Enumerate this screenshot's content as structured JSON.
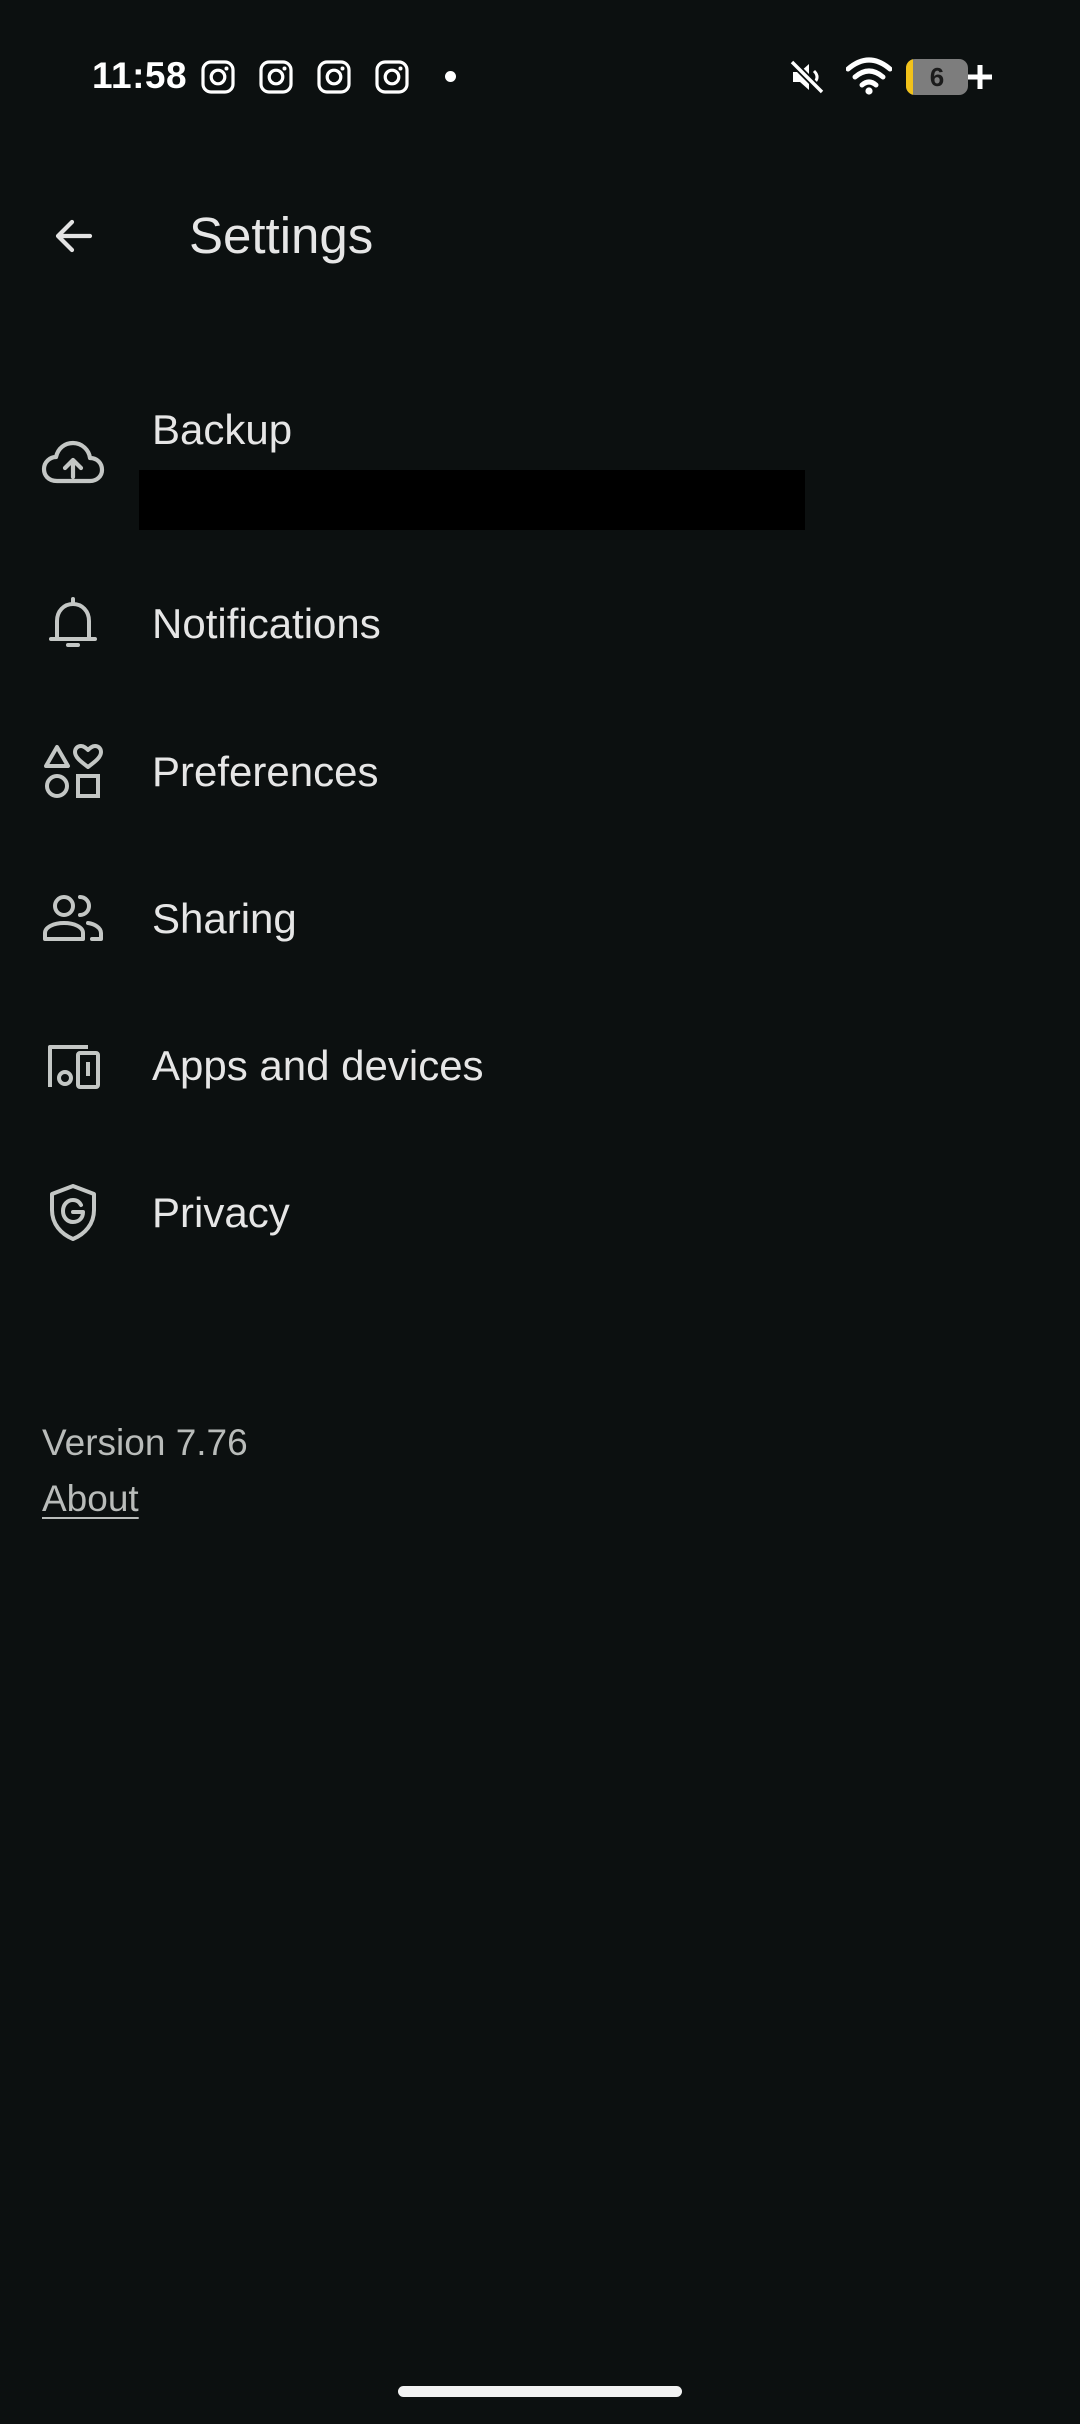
{
  "status_bar": {
    "time": "11:58",
    "notification_icons": [
      "instagram-icon",
      "instagram-icon",
      "instagram-icon",
      "instagram-icon"
    ],
    "battery_level": "6",
    "battery_fraction": 0.06,
    "battery_color": "#f2c21a",
    "indicators": [
      "mute-icon",
      "wifi-icon",
      "battery-charging-icon"
    ]
  },
  "app_bar": {
    "title": "Settings",
    "back_icon": "arrow-back-icon"
  },
  "settings": {
    "items": [
      {
        "label": "Backup",
        "icon": "cloud-upload-icon",
        "subtitle_redacted": true
      },
      {
        "label": "Notifications",
        "icon": "bell-icon"
      },
      {
        "label": "Preferences",
        "icon": "shapes-icon"
      },
      {
        "label": "Sharing",
        "icon": "people-icon"
      },
      {
        "label": "Apps and devices",
        "icon": "devices-icon"
      },
      {
        "label": "Privacy",
        "icon": "shield-icon"
      }
    ]
  },
  "footer": {
    "version": "Version 7.76",
    "about_label": "About"
  },
  "colors": {
    "background": "#0c1010",
    "text_primary": "#e6e6e6",
    "text_secondary": "#b9bcba",
    "icon": "#c4c7c5"
  }
}
